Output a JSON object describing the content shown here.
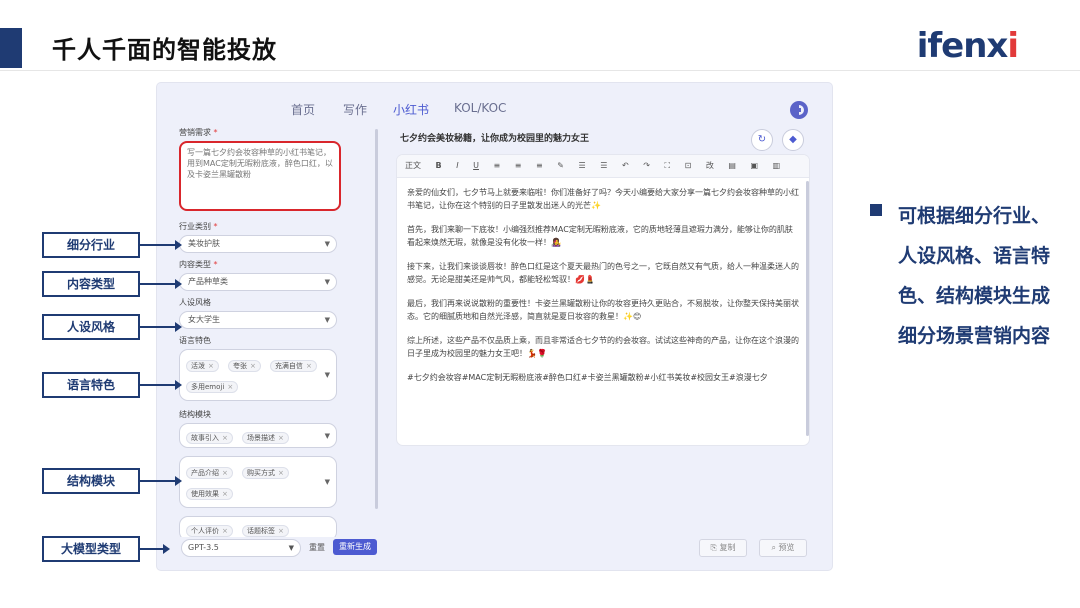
{
  "slide": {
    "title": "千人千面的智能投放",
    "logo_main": "ifenx",
    "logo_accent": "i"
  },
  "nav": {
    "items": [
      "首页",
      "写作",
      "小红书",
      "KOL/KOC"
    ],
    "active": "小红书"
  },
  "form": {
    "marketing_label": "营销需求",
    "marketing_value": "写一篇七夕约会妆容种草的小红书笔记，用到MAC定制无暇粉底液，醉色口红，以及卡姿兰黑罐散粉",
    "industry_label": "行业类别",
    "industry_value": "美妆护肤",
    "content_label": "内容类型",
    "content_value": "产品种草类",
    "persona_label": "人设风格",
    "persona_value": "女大学生",
    "language_label": "语言特色",
    "language_tags": [
      "活泼",
      "夸张",
      "充满自信",
      "多用emoji"
    ],
    "structure_label": "结构模块",
    "structure_tags1": [
      "故事引入",
      "场景描述"
    ],
    "structure_tags2": [
      "产品介绍",
      "购买方式",
      "使用效果"
    ],
    "structure_tags3": [
      "个人评价",
      "话题标签"
    ],
    "model_value": "GPT-3.5",
    "reset_label": "重置",
    "regen_label": "重新生成"
  },
  "output": {
    "title": "七夕约会美妆秘籍，让你成为校园里的魅力女王",
    "toolbar": [
      "正文",
      "B",
      "I",
      "U",
      "≡",
      "≡",
      "≡",
      "✎",
      "☰",
      "☰",
      "↶",
      "↷",
      "⛶",
      "⊡",
      "改",
      "▤",
      "▣",
      "▥"
    ],
    "paragraphs": [
      "亲爱的仙女们，七夕节马上就要来临啦！你们准备好了吗？今天小编要给大家分享一篇七夕约会妆容种草的小红书笔记，让你在这个特别的日子里散发出迷人的光芒✨",
      "首先，我们来聊一下底妆！小编强烈推荐MAC定制无暇粉底液，它的质地轻薄且遮瑕力满分，能够让你的肌肤看起来焕然无瑕，就像是没有化妆一样！👩‍🎤",
      "接下来，让我们来谈谈唇妆！醉色口红是这个夏天最热门的色号之一，它既自然又有气质，给人一种温柔迷人的感觉。无论是甜美还是帅气风，都能轻松驾驭！💋💄",
      "最后，我们再来说说散粉的重要性！卡姿兰黑罐散粉让你的妆容更持久更贴合，不易脱妆，让你整天保持美丽状态。它的细腻质地和自然光泽感，简直就是夏日妆容的救星！✨😊",
      "综上所述，这些产品不仅品质上乘，而且非常适合七夕节的约会妆容。试试这些神奇的产品，让你在这个浪漫的日子里成为校园里的魅力女王吧！💃🌹",
      "#七夕约会妆容#MAC定制无暇粉底液#醉色口红#卡姿兰黑罐散粉#小红书美妆#校园女王#浪漫七夕"
    ],
    "copy_label": "复制",
    "preview_label": "预览"
  },
  "callouts": [
    "细分行业",
    "内容类型",
    "人设风格",
    "语言特色",
    "结构模块",
    "大模型类型"
  ],
  "summary": {
    "text": "可根据细分行业、人设风格、语言特色、结构模块生成细分场景营销内容"
  },
  "colors": {
    "brand": "#1f3b73",
    "accent": "#4d5bd1",
    "highlight": "#d9262c"
  }
}
